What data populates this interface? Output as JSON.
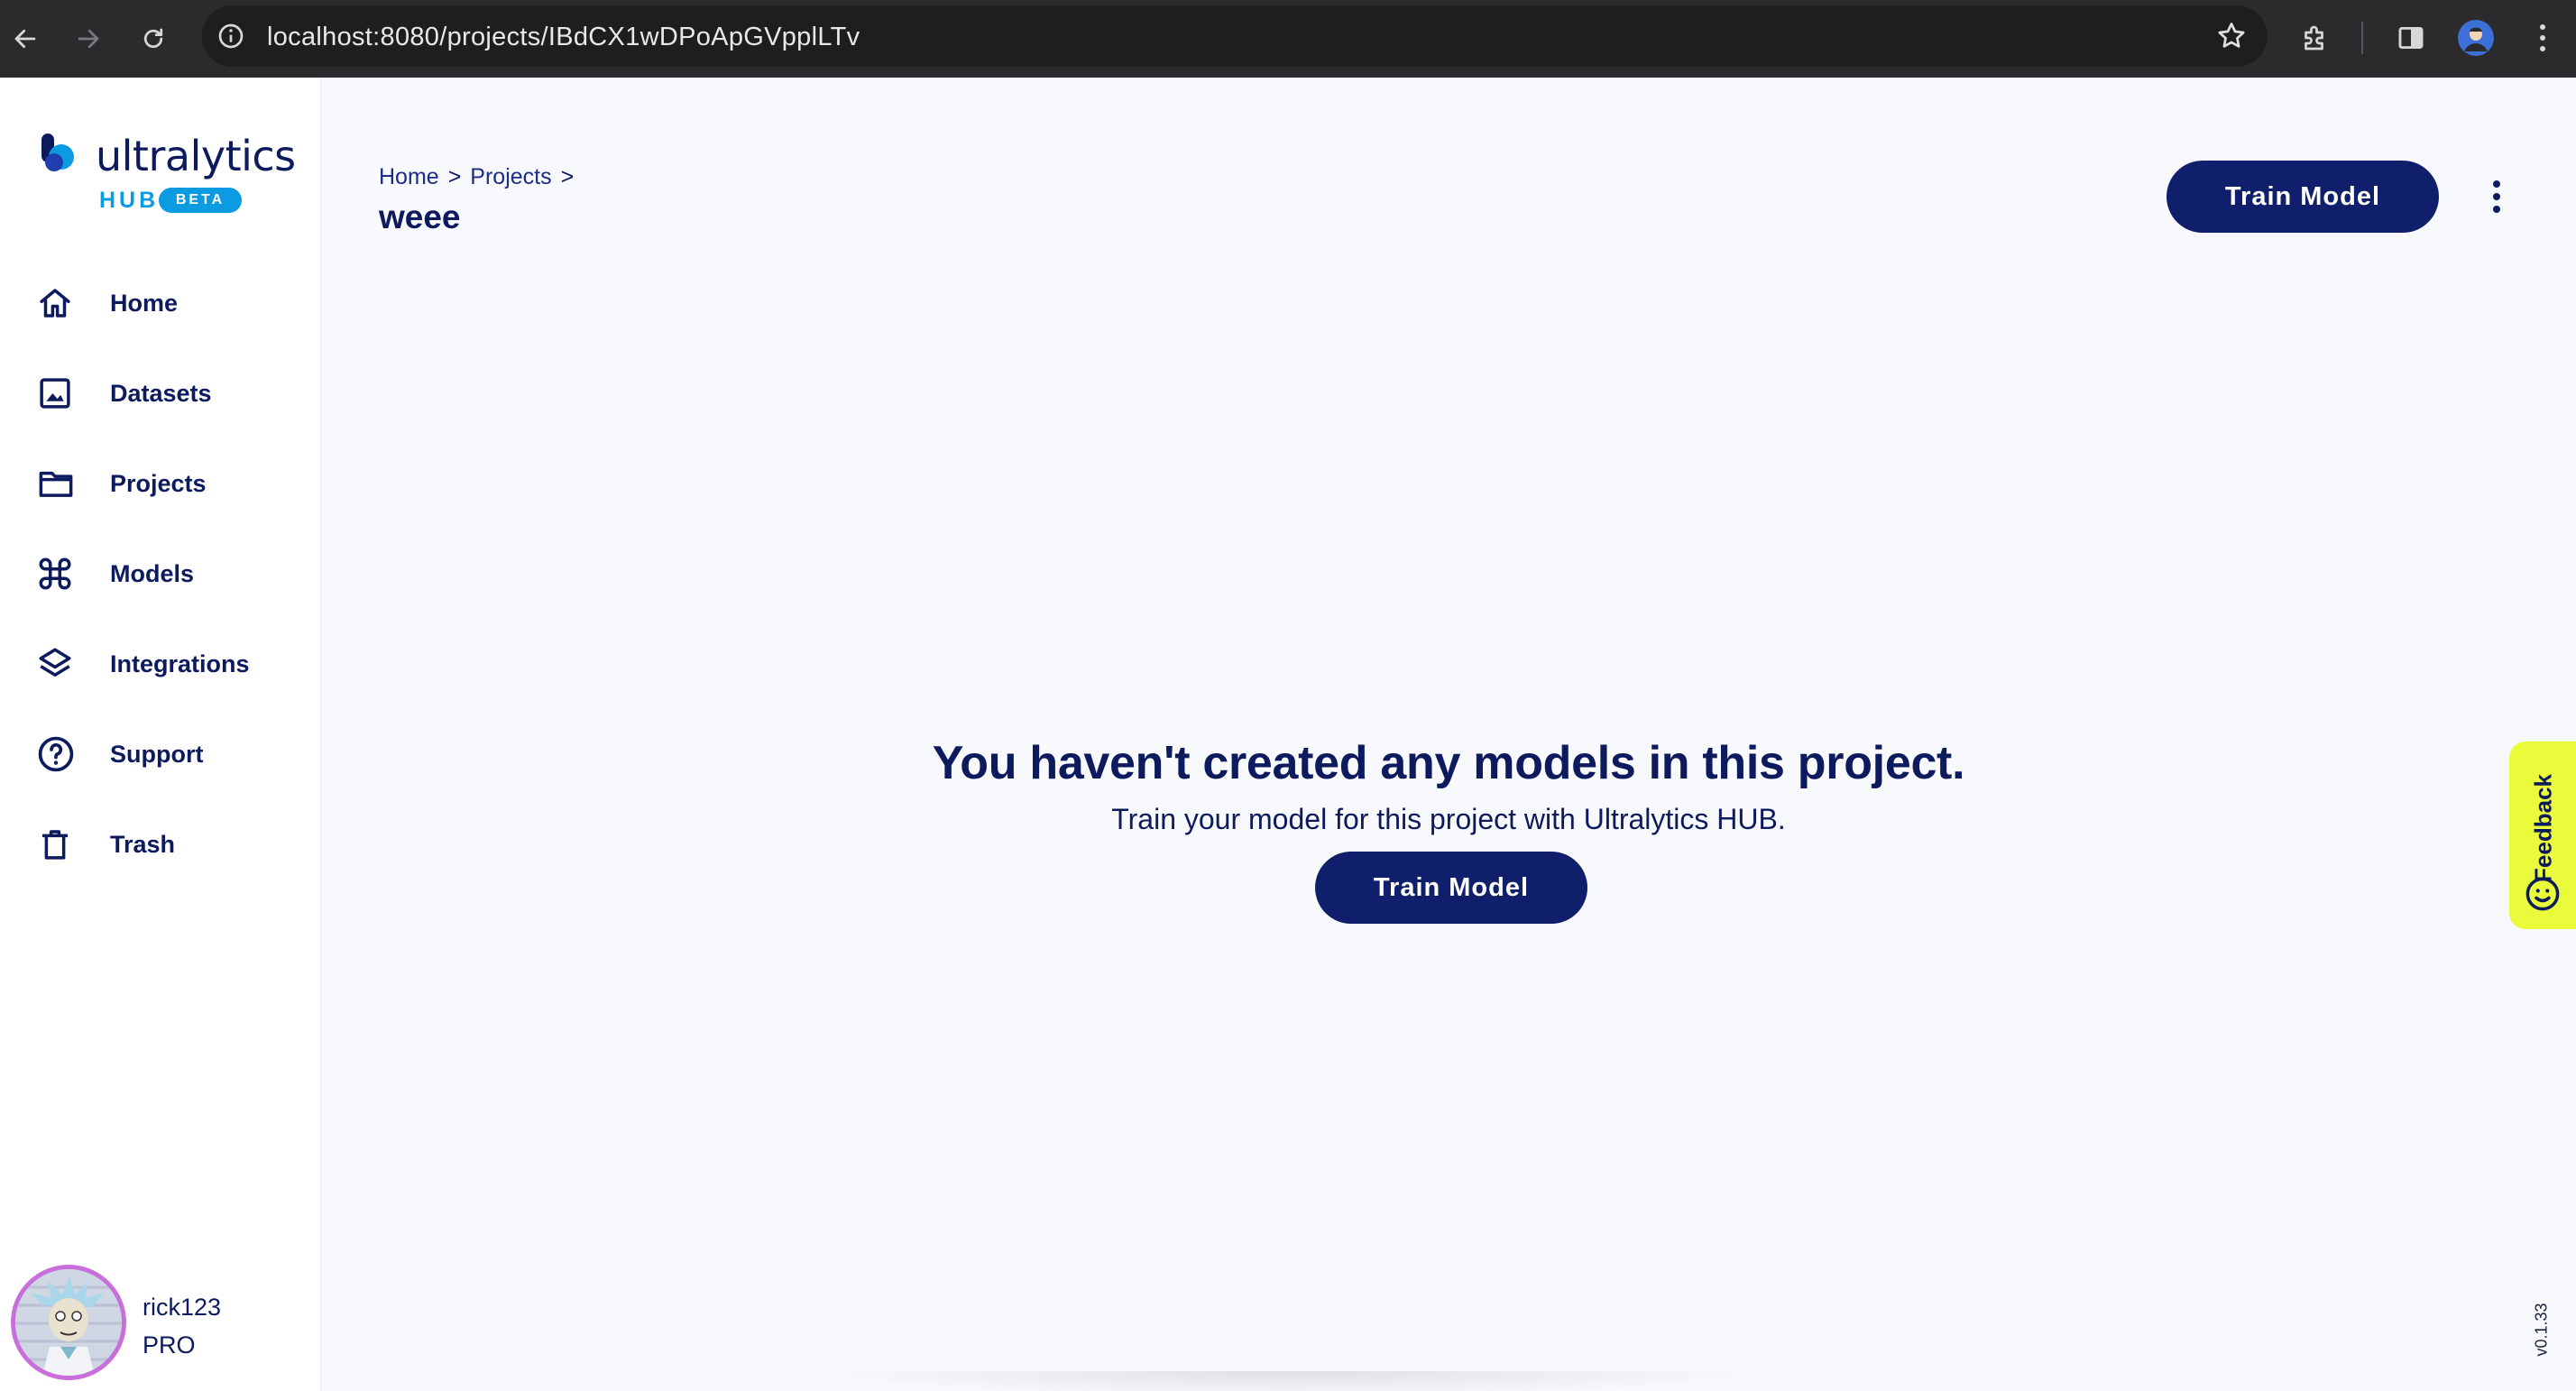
{
  "browser": {
    "url": "localhost:8080/projects/IBdCX1wDPoApGVpplLTv"
  },
  "sidebar": {
    "logo": {
      "word": "ultralytics",
      "hub": "HUB",
      "badge": "BETA"
    },
    "items": [
      {
        "label": "Home",
        "icon": "home-icon"
      },
      {
        "label": "Datasets",
        "icon": "image-icon"
      },
      {
        "label": "Projects",
        "icon": "folder-icon"
      },
      {
        "label": "Models",
        "icon": "command-icon"
      },
      {
        "label": "Integrations",
        "icon": "layers-icon"
      },
      {
        "label": "Support",
        "icon": "help-circle-icon"
      },
      {
        "label": "Trash",
        "icon": "trash-icon"
      }
    ],
    "user": {
      "name": "rick123",
      "plan": "PRO"
    }
  },
  "header": {
    "breadcrumb": [
      "Home",
      "Projects"
    ],
    "breadcrumb_sep": ">",
    "title": "weee",
    "train_button": "Train Model"
  },
  "empty_state": {
    "title": "You haven't created any models in this project.",
    "subtitle": "Train your model for this project with Ultralytics HUB.",
    "button": "Train Model"
  },
  "feedback": {
    "label": "Feedback"
  },
  "version": "v0.1.33",
  "colors": {
    "primary": "#0f1f6b",
    "text": "#0d1b5e",
    "accent": "#0b9be3",
    "feedback": "#e9fb3b"
  }
}
